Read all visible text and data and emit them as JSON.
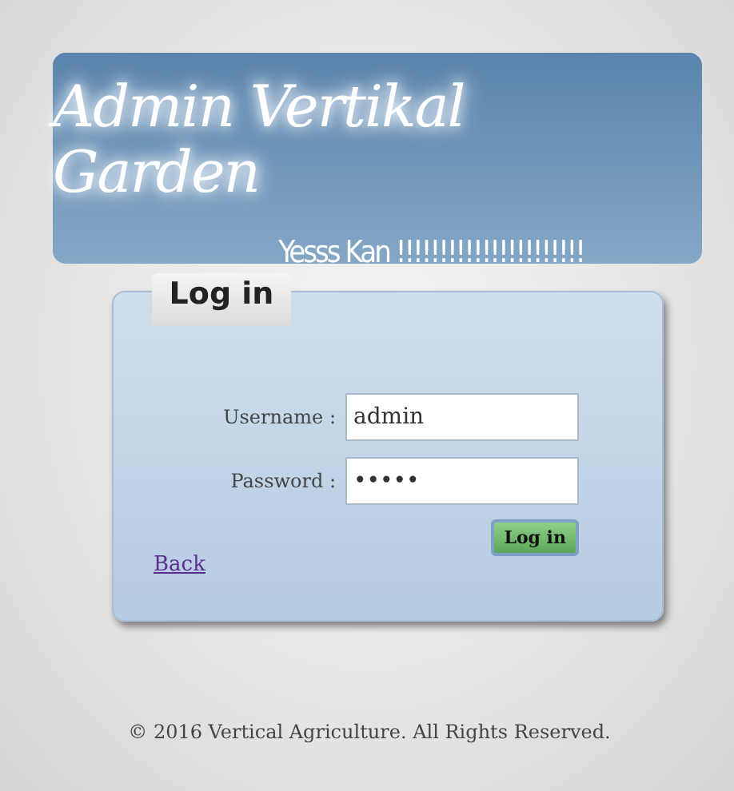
{
  "header": {
    "title": "Admin Vertikal Garden",
    "subtitle": "Yesss Kan !!!!!!!!!!!!!!!!!!!!!!"
  },
  "login_panel": {
    "tab": "Log in",
    "fields": [
      {
        "label": "Username :",
        "value": "admin"
      },
      {
        "label": "Password :",
        "value": "•••••"
      }
    ],
    "submit": "Log in",
    "back_link": "Back"
  },
  "footer": "© 2016 Vertical Agriculture. All Rights Reserved."
}
